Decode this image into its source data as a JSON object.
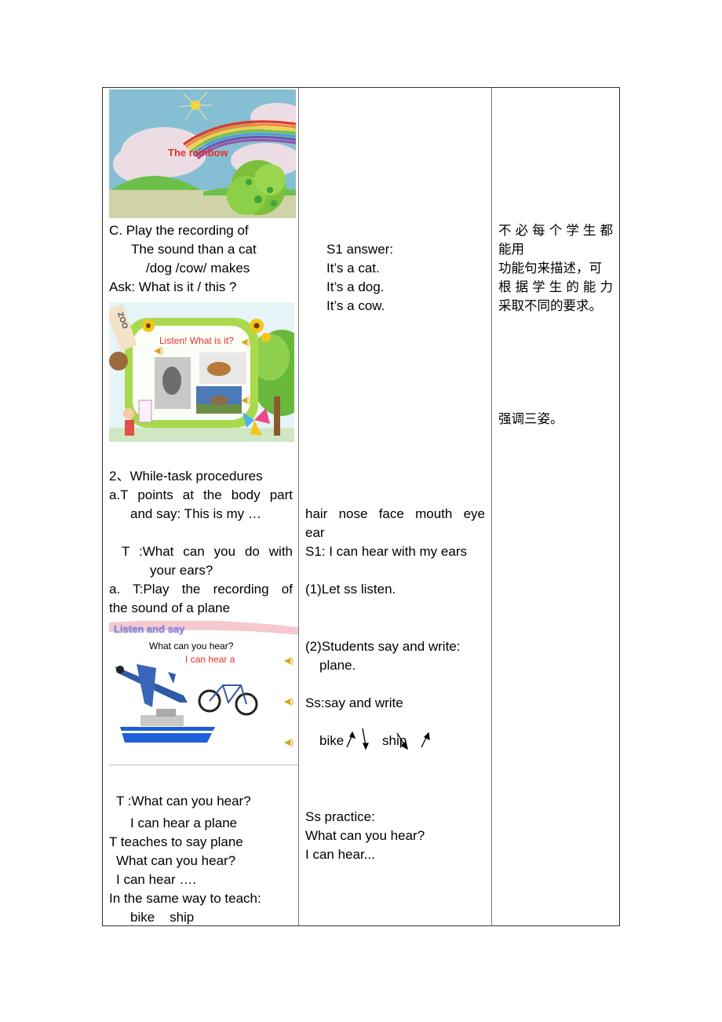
{
  "col1": {
    "slide_rainbow": {
      "title": "The rainbow"
    },
    "section_c": {
      "line1": "C. Play the recording of",
      "line2": "The sound than a cat",
      "line3": "/dog /cow/ makes",
      "line4": "Ask: What is it / this ?"
    },
    "slide_listen": {
      "title": "Listen! What is it?",
      "zoo_sign": "ZOO"
    },
    "while_task": {
      "heading": "2、While-task procedures",
      "a_line1": "a.T points at the body part",
      "a_line2": "and say: This is my …",
      "t_line1": "T :What can you do with",
      "t_line2": "your ears?",
      "b_line1": "a. T:Play the recording of",
      "b_line2": "the sound of a plane"
    },
    "slide_listen_say": {
      "header": "Listen and say",
      "question": "What can you hear?",
      "answer": "I can hear a"
    },
    "practice": {
      "line1": "T :What can you hear?",
      "line2": "I can hear a plane",
      "line3": "T teaches to say plane",
      "line4": "What can you hear?",
      "line5": "I can hear ….",
      "line6": "In the same way to teach:",
      "line7": "bike    ship"
    }
  },
  "col2": {
    "s1_answer": "S1 answer:",
    "answers": [
      "It’s a cat.",
      "It’s a dog.",
      "It’s a cow."
    ],
    "body_parts_line1": "hair  nose  face  mouth  eye",
    "body_parts_line2": "ear",
    "s1_hear": "S1: I can hear with my ears",
    "step1": "(1)Let ss listen.",
    "step2_line1": "(2)Students say and write:",
    "step2_line2": "plane.",
    "ss_say_write": "Ss:say and write",
    "intonation_word1": "bike",
    "intonation_word2": "ship",
    "practice_heading": "Ss practice:",
    "practice_q": "What can you hear?",
    "practice_a": "I can hear..."
  },
  "col3": {
    "note1_line1": "不必每个学生都",
    "note1_line2": "能用",
    "note1_line3": "功能句来描述，可",
    "note1_line4": "根据学生的能力",
    "note1_line5": "采取不同的要求。",
    "note2": "强调三姿。"
  },
  "colors": {
    "slide_title_red": "#e8302a",
    "listen_say_header": "#8f8fe6",
    "speaker_gold": "#d9a520"
  }
}
